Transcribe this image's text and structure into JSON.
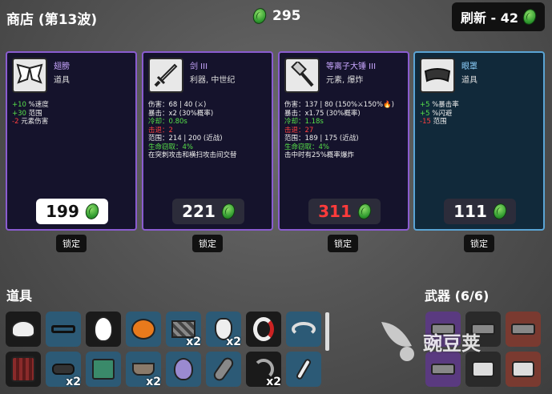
{
  "header": {
    "title": "商店 (第13波)",
    "materials": "295",
    "refresh_label": "刷新 - 42"
  },
  "cards": [
    {
      "name": "翅膀",
      "type": "道具",
      "icon": "wings-icon",
      "price": "199",
      "stats": [
        [
          "+10",
          "%速度",
          "g"
        ],
        [
          "+30",
          "范围",
          "g"
        ],
        [
          "-2",
          "元素伤害",
          "r"
        ]
      ]
    },
    {
      "name": "剑 III",
      "type": "利器, 中世纪",
      "icon": "sword-icon",
      "price": "221",
      "lines": [
        "伤害：68 | 40 (⚔)",
        "暴击：x2 (30%概率)",
        "冷却：0.80s",
        "击退：2",
        "范围：214 | 200 (近战)",
        "生命窃取：4%",
        "在突刺攻击和横扫攻击间交替"
      ]
    },
    {
      "name": "等离子大锤 III",
      "type": "元素, 爆炸",
      "icon": "hammer-icon",
      "price": "311",
      "lines": [
        "伤害：137 | 80 (150%⚔150%🔥)",
        "暴击：x1.75 (30%概率)",
        "冷却：1.18s",
        "击退：27",
        "范围：189 | 175 (近战)",
        "生命窃取：4%",
        "击中时有25%概率爆炸"
      ]
    },
    {
      "name": "眼罩",
      "type": "道具",
      "icon": "blindfold-icon",
      "price": "111",
      "stats": [
        [
          "+5",
          "%暴击率",
          "g"
        ],
        [
          "+5",
          "%闪避",
          "g"
        ],
        [
          "-15",
          "范围",
          "r"
        ]
      ]
    }
  ],
  "lock_label": "锁定",
  "items_label": "道具",
  "weapons_label": "武器 (6/6)",
  "items": [
    {
      "icon": "bandana-icon",
      "qty": ""
    },
    {
      "icon": "glasses-icon",
      "qty": ""
    },
    {
      "icon": "egg-icon",
      "qty": ""
    },
    {
      "icon": "pumpkin-icon",
      "qty": ""
    },
    {
      "icon": "scarf-icon",
      "qty": "x2"
    },
    {
      "icon": "rabbit-icon",
      "qty": "x2"
    },
    {
      "icon": "bracelet-icon",
      "qty": ""
    },
    {
      "icon": "worm-icon",
      "qty": ""
    },
    {
      "icon": "jacket-icon",
      "qty": ""
    },
    {
      "icon": "blindfold-icon",
      "qty": "x2"
    },
    {
      "icon": "machine-icon",
      "qty": ""
    },
    {
      "icon": "wheelbarrow-icon",
      "qty": "x2"
    },
    {
      "icon": "potion-icon",
      "qty": ""
    },
    {
      "icon": "bandage-icon",
      "qty": ""
    },
    {
      "icon": "scythe-icon",
      "qty": "x2"
    },
    {
      "icon": "bone-icon",
      "qty": ""
    }
  ],
  "watermark": "豌豆荚"
}
